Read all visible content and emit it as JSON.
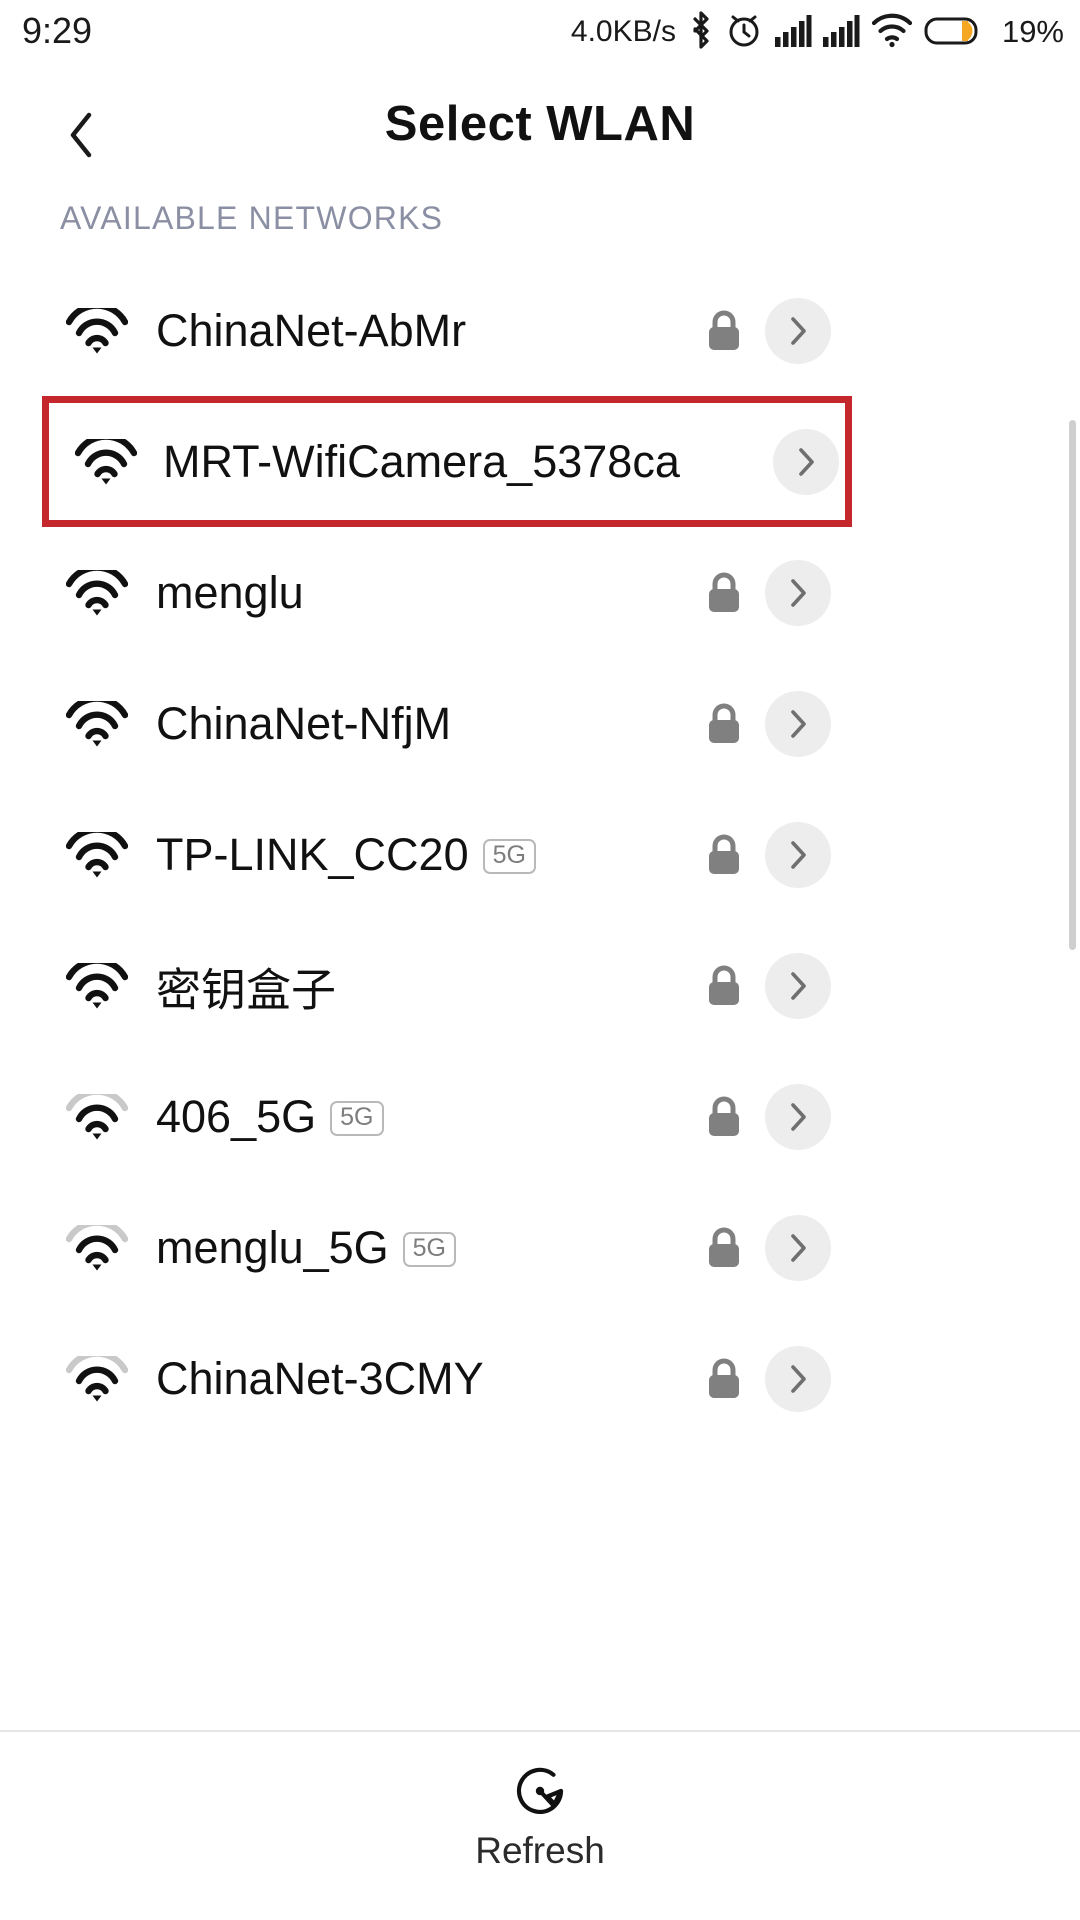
{
  "status_bar": {
    "time": "9:29",
    "network_speed": "4.0KB/s",
    "battery_percent": "19%",
    "icons": [
      "bluetooth-icon",
      "alarm-icon",
      "signal-bars-icon",
      "signal-bars-icon",
      "wifi-icon",
      "battery-icon"
    ],
    "battery_fill_color": "#f5a623"
  },
  "header": {
    "back_label": "‹",
    "title": "Select WLAN"
  },
  "section": {
    "label": "AVAILABLE NETWORKS",
    "label_color": "#8b8fa3"
  },
  "highlight": {
    "color": "#c4282c",
    "target_ssid": "MRT-WifiCamera_5378ca"
  },
  "networks": [
    {
      "ssid": "ChinaNet-AbMr",
      "secured": true,
      "band_badge": "",
      "signal": 3,
      "highlighted": false
    },
    {
      "ssid": "MRT-WifiCamera_5378ca",
      "secured": false,
      "band_badge": "",
      "signal": 3,
      "highlighted": true
    },
    {
      "ssid": "menglu",
      "secured": true,
      "band_badge": "",
      "signal": 3,
      "highlighted": false
    },
    {
      "ssid": "ChinaNet-NfjM",
      "secured": true,
      "band_badge": "",
      "signal": 3,
      "highlighted": false
    },
    {
      "ssid": "TP-LINK_CC20",
      "secured": true,
      "band_badge": "5G",
      "signal": 3,
      "highlighted": false
    },
    {
      "ssid": "密钥盒子",
      "secured": true,
      "band_badge": "",
      "signal": 3,
      "highlighted": false
    },
    {
      "ssid": "406_5G",
      "secured": true,
      "band_badge": "5G",
      "signal": 2,
      "highlighted": false
    },
    {
      "ssid": "menglu_5G",
      "secured": true,
      "band_badge": "5G",
      "signal": 2,
      "highlighted": false
    },
    {
      "ssid": "ChinaNet-3CMY",
      "secured": true,
      "band_badge": "",
      "signal": 2,
      "highlighted": false
    }
  ],
  "bottom_bar": {
    "refresh_label": "Refresh",
    "refresh_icon": "refresh-clock-icon"
  }
}
